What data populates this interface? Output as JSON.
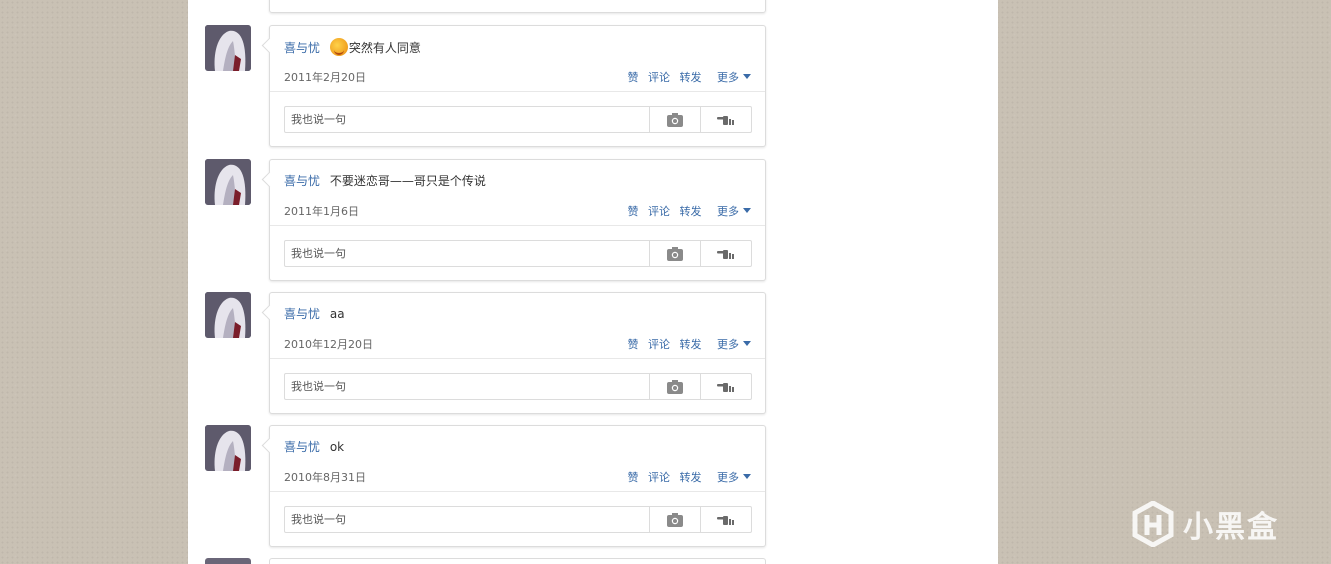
{
  "feed": {
    "posts": [
      {
        "author": "喜与忧",
        "has_emoji": true,
        "content": "突然有人同意",
        "date": "2011年2月20日",
        "actions": {
          "like": "赞",
          "comment": "评论",
          "repost": "转发",
          "more": "更多"
        },
        "comment_placeholder": "我也说一句"
      },
      {
        "author": "喜与忧",
        "has_emoji": false,
        "content": "不要迷恋哥——哥只是个传说",
        "date": "2011年1月6日",
        "actions": {
          "like": "赞",
          "comment": "评论",
          "repost": "转发",
          "more": "更多"
        },
        "comment_placeholder": "我也说一句"
      },
      {
        "author": "喜与忧",
        "has_emoji": false,
        "content": "aa",
        "date": "2010年12月20日",
        "actions": {
          "like": "赞",
          "comment": "评论",
          "repost": "转发",
          "more": "更多"
        },
        "comment_placeholder": "我也说一句"
      },
      {
        "author": "喜与忧",
        "has_emoji": false,
        "content": "ok",
        "date": "2010年8月31日",
        "actions": {
          "like": "赞",
          "comment": "评论",
          "repost": "转发",
          "more": "更多"
        },
        "comment_placeholder": "我也说一句"
      }
    ]
  },
  "icons": {
    "photo": "camera-icon",
    "thumb": "pointing-hand-icon",
    "emoji": "smiley-emoji-icon",
    "caret": "caret-down-icon"
  },
  "colors": {
    "link": "#3a6ba8",
    "background": "#c9c1b4",
    "card_border": "#dcdcdc"
  },
  "watermark": {
    "text": "小黑盒"
  }
}
